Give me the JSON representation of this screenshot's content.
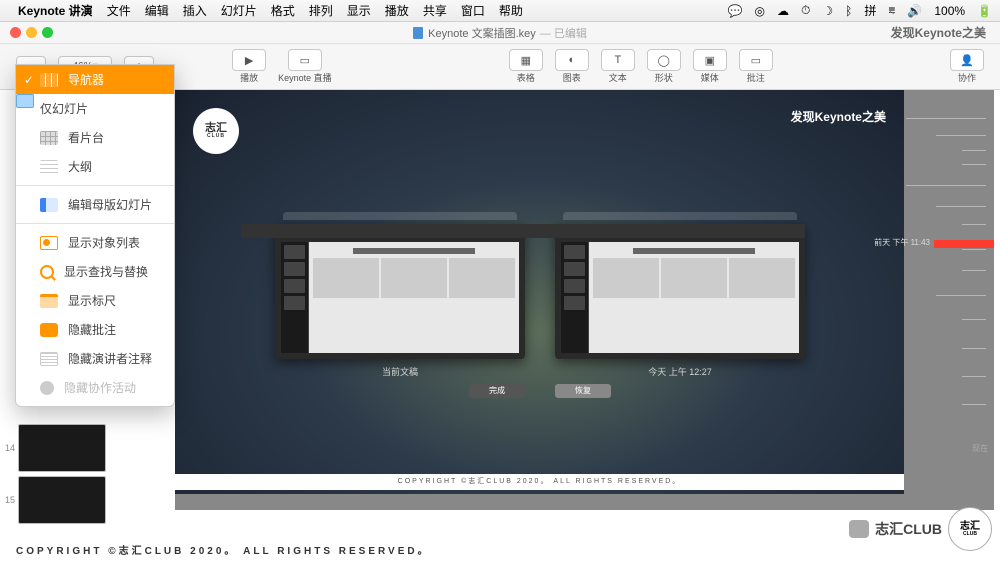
{
  "menubar": {
    "app": "Keynote 讲演",
    "items": [
      "文件",
      "编辑",
      "插入",
      "幻灯片",
      "格式",
      "排列",
      "显示",
      "播放",
      "共享",
      "窗口",
      "帮助"
    ],
    "battery": "100%"
  },
  "titlebar": {
    "doc": "Keynote 文案插图.key",
    "status": "— 已编辑",
    "brand": "发现Keynote之美"
  },
  "toolbar": {
    "zoom": "46%",
    "play": "播放",
    "live": "Keynote 直播",
    "table": "表格",
    "chart": "图表",
    "text": "文本",
    "shape": "形状",
    "media": "媒体",
    "comment": "批注",
    "collab": "协作"
  },
  "dropdown": {
    "items": [
      {
        "label": "导航器",
        "icon": "nav",
        "selected": true
      },
      {
        "label": "仅幻灯片",
        "icon": "slide"
      },
      {
        "label": "看片台",
        "icon": "grid"
      },
      {
        "label": "大纲",
        "icon": "outline"
      }
    ],
    "section2": [
      {
        "label": "编辑母版幻灯片",
        "icon": "master"
      }
    ],
    "section3": [
      {
        "label": "显示对象列表",
        "icon": "objects"
      },
      {
        "label": "显示查找与替换",
        "icon": "search"
      },
      {
        "label": "显示标尺",
        "icon": "ruler"
      },
      {
        "label": "隐藏批注",
        "icon": "comment"
      },
      {
        "label": "隐藏演讲者注释",
        "icon": "notes"
      },
      {
        "label": "隐藏协作活动",
        "icon": "collab-i",
        "disabled": true
      }
    ]
  },
  "thumbs": {
    "n1": "14",
    "n2": "15"
  },
  "slide": {
    "logo_top": "志汇",
    "logo_sub": "CLUB",
    "brand": "发现Keynote之美",
    "copyright": "COPYRIGHT ©志汇CLUB 2020。 ALL RIGHTS RESERVED。",
    "versions": {
      "left_label": "当前文稿",
      "right_label": "今天 上午 12:27",
      "btn_done": "完成",
      "btn_restore": "恢复"
    },
    "timeline_label": "前天 下午 11:43",
    "timeline_now": "现在"
  },
  "watermark": {
    "text": "志汇CLUB",
    "logo_top": "志汇",
    "logo_sub": "CLUB"
  },
  "footer": "COPYRIGHT ©志汇CLUB 2020。 ALL RIGHTS RESERVED。"
}
